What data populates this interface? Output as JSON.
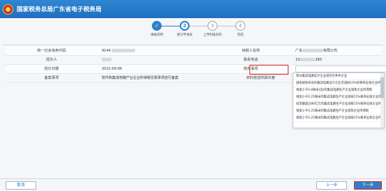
{
  "header": {
    "title": "国家税务总局广东省电子税务局"
  },
  "steps": [
    {
      "num": "✓",
      "label": "填报说明",
      "state": "done"
    },
    {
      "num": "2",
      "label": "填写申请表",
      "state": "active"
    },
    {
      "num": "3",
      "label": "上传附报资料",
      "state": "todo"
    },
    {
      "num": "4",
      "label": "完成",
      "state": "todo"
    }
  ],
  "form": {
    "rows": [
      {
        "label": "统一社会信用代码",
        "value": "9144",
        "label2": "纳税人名称",
        "value2": "广东",
        "value2_suffix": "有限公司"
      },
      {
        "label": "经办人",
        "value": "",
        "label2": "联系电话",
        "value2": "15",
        "value2_suffix": "280"
      },
      {
        "label": "经办日期",
        "value": "2022-09-06",
        "label2": "税务事项",
        "value2": "",
        "value2_suffix": ""
      },
      {
        "label": "备案事项",
        "value": "软件和集成电路产业企业所得税优惠事项自行备案",
        "label2": "资料报送所属年度",
        "value2": "",
        "value2_suffix": ""
      }
    ]
  },
  "dropdown": {
    "options": [
      "新办集成电路设计企业或符合条件企业",
      "国家规划布局内集成电路设计企业可减按10%的税率征收企业所得税",
      "线宽小于0.8微米(含)的集成电路生产企业减免企业所得税",
      "线宽小于0.25微米的集成电路生产企业减按15%税率征收企业所得税",
      "投资额超过80亿元的集成电路生产企业减按15%税率征收企业所得税",
      "线宽小于0.25微米的集成电路生产企业减免企业所得税",
      "线宽小于0.25微米的集成电路生产企业减按15%税率征收企业所得税"
    ]
  },
  "buttons": {
    "cancel": "取消",
    "prev": "上一步",
    "next": "下一步"
  }
}
